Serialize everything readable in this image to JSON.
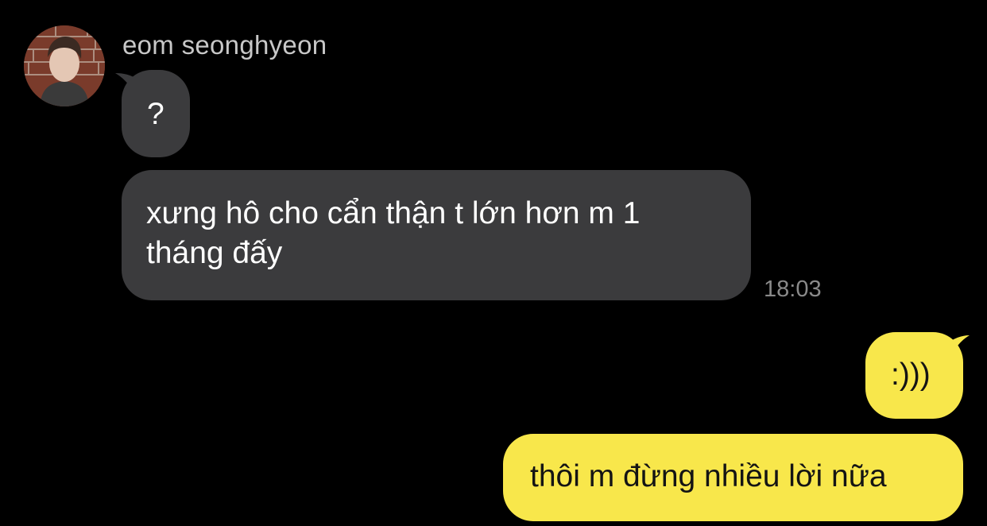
{
  "chat": {
    "sender_name": "eom seonghyeon",
    "avatar_icon": "profile-photo",
    "colors": {
      "background": "#000000",
      "incoming_bubble": "#3b3b3d",
      "outgoing_bubble": "#f8e74b",
      "incoming_text": "#ffffff",
      "outgoing_text": "#141414",
      "timestamp": "#8a8a8a",
      "name": "#c8c8c8"
    },
    "messages": [
      {
        "direction": "incoming",
        "text": "?"
      },
      {
        "direction": "incoming",
        "text": "xưng hô cho cẩn thận t lớn hơn m 1 tháng đấy",
        "time": "18:03"
      },
      {
        "direction": "outgoing",
        "text": ":)))"
      },
      {
        "direction": "outgoing",
        "text": "thôi m đừng nhiều lời nữa"
      }
    ]
  }
}
